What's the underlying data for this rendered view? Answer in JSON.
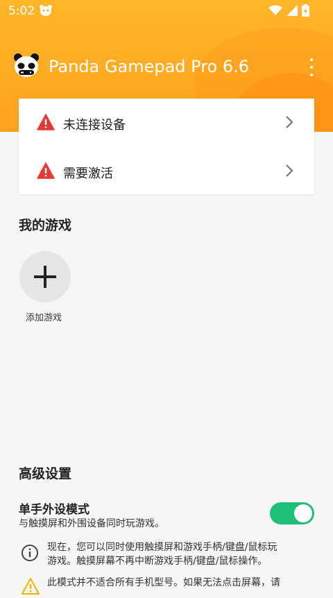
{
  "status_bar": {
    "time": "5:02"
  },
  "app_bar": {
    "title": "Panda Gamepad Pro 6.6"
  },
  "status_card": {
    "items": [
      {
        "label": "未连接设备"
      },
      {
        "label": "需要激活"
      }
    ]
  },
  "my_games": {
    "title": "我的游戏",
    "add_label": "添加游戏"
  },
  "advanced": {
    "title": "高级设置",
    "one_hand": {
      "title": "单手外设模式",
      "description": "与触摸屏和外围设备同时玩游戏。",
      "enabled": true
    },
    "info_note": {
      "line1": "现在，您可以同时使用触摸屏和游戏手柄/键盘/鼠标玩",
      "line2": "游戏。触摸屏幕不再中断游戏手柄/键盘/鼠标操作。"
    },
    "warning_note": {
      "line1": "此模式并不适合所有手机型号。如果无法点击屏幕，请"
    }
  },
  "colors": {
    "header_orange": "#ffaa22",
    "warning_red": "#e53935",
    "toggle_green": "#1fbf7a"
  }
}
